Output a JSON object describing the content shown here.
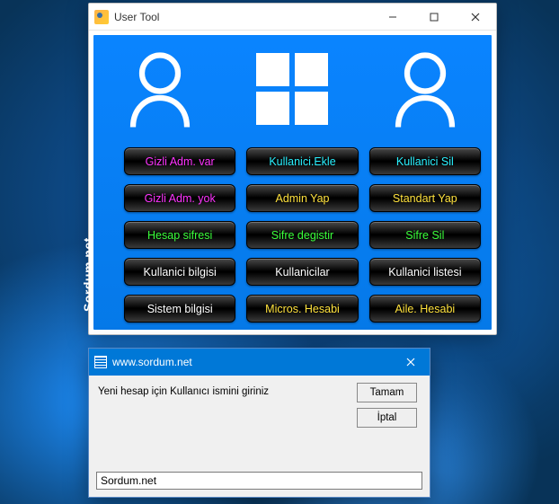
{
  "tool_window": {
    "title": "User Tool",
    "brand_vertical": "Sordum.net",
    "buttons": [
      {
        "label": "Gizli Adm. var",
        "color": "magenta"
      },
      {
        "label": "Kullanici.Ekle",
        "color": "cyan"
      },
      {
        "label": "Kullanici Sil",
        "color": "cyan"
      },
      {
        "label": "Gizli Adm. yok",
        "color": "magenta"
      },
      {
        "label": "Admin Yap",
        "color": "yellow"
      },
      {
        "label": "Standart Yap",
        "color": "yellow"
      },
      {
        "label": "Hesap sifresi",
        "color": "lime"
      },
      {
        "label": "Sifre degistir",
        "color": "lime"
      },
      {
        "label": "Sifre Sil",
        "color": "lime"
      },
      {
        "label": "Kullanici bilgisi",
        "color": "white"
      },
      {
        "label": "Kullanicilar",
        "color": "white"
      },
      {
        "label": "Kullanici listesi",
        "color": "white"
      },
      {
        "label": "Sistem bilgisi",
        "color": "white"
      },
      {
        "label": "Micros. Hesabi",
        "color": "yellow"
      },
      {
        "label": "Aile. Hesabi",
        "color": "yellow"
      }
    ]
  },
  "dialog": {
    "title": "www.sordum.net",
    "message": "Yeni hesap için Kullanıcı ismini giriniz",
    "ok_label": "Tamam",
    "cancel_label": "İptal",
    "input_value": "Sordum.net"
  }
}
